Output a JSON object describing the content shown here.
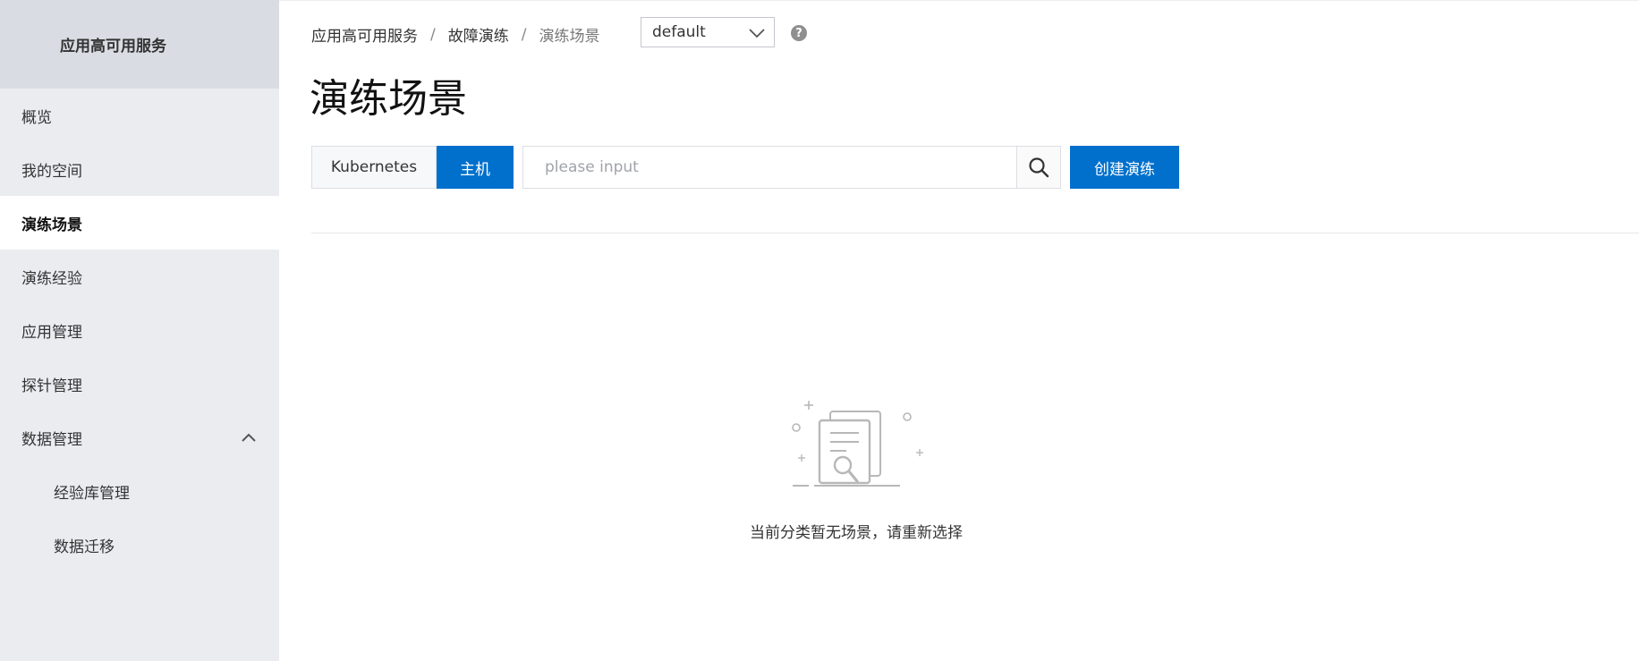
{
  "sidebar": {
    "title": "应用高可用服务",
    "items": [
      {
        "label": "概览"
      },
      {
        "label": "我的空间"
      },
      {
        "label": "演练场景"
      },
      {
        "label": "演练经验"
      },
      {
        "label": "应用管理"
      },
      {
        "label": "探针管理"
      },
      {
        "label": "数据管理"
      },
      {
        "label": "经验库管理"
      },
      {
        "label": "数据迁移"
      }
    ],
    "active_item": "演练场景",
    "expanded_item": "数据管理"
  },
  "breadcrumb": {
    "items": [
      "应用高可用服务",
      "故障演练",
      "演练场景"
    ],
    "separator": "/"
  },
  "namespace_select": {
    "value": "default"
  },
  "help": {
    "glyph": "?"
  },
  "page": {
    "title": "演练场景"
  },
  "toolbar": {
    "tabs": [
      {
        "label": "Kubernetes",
        "selected": false
      },
      {
        "label": "主机",
        "selected": true
      }
    ],
    "search_placeholder": "please input",
    "create_label": "创建演练"
  },
  "empty_state": {
    "message": "当前分类暂无场景，请重新选择"
  },
  "colors": {
    "primary": "#0070cc",
    "sidebar_bg": "#ebecf0",
    "sidebar_header_bg": "#d9dce2"
  },
  "icons": {
    "search": "search-icon",
    "dropdown": "chevron-down-icon",
    "collapse": "chevron-up-icon",
    "help": "help-icon",
    "empty": "empty-document-search-icon"
  }
}
